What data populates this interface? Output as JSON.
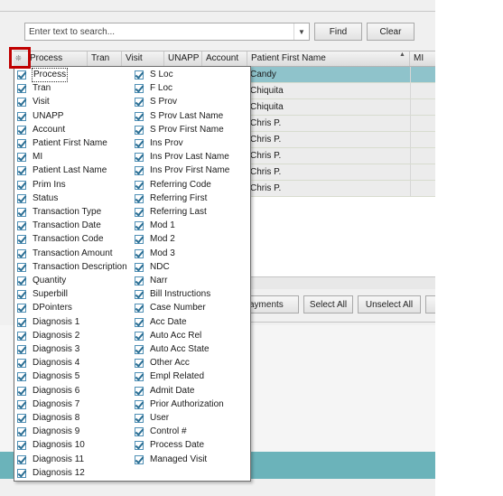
{
  "search": {
    "placeholder": "Enter text to search...",
    "value": ""
  },
  "buttons": {
    "find": "Find",
    "clear": "Clear",
    "payments_partial": "ayments",
    "select_all": "Select All",
    "unselect_all": "Unselect All"
  },
  "grid": {
    "columns": [
      "Process",
      "Tran",
      "Visit",
      "UNAPP",
      "Account",
      "Patient First Name",
      "MI"
    ],
    "rows": [
      {
        "patient_first_name": "Candy",
        "selected": true
      },
      {
        "patient_first_name": "Chiquita",
        "selected": false
      },
      {
        "patient_first_name": "Chiquita",
        "selected": false
      },
      {
        "patient_first_name": "Chris P.",
        "selected": false
      },
      {
        "patient_first_name": "Chris P.",
        "selected": false
      },
      {
        "patient_first_name": "Chris P.",
        "selected": false
      },
      {
        "patient_first_name": "Chris P.",
        "selected": false
      },
      {
        "patient_first_name": "Chris P.",
        "selected": false
      }
    ]
  },
  "column_chooser": {
    "left": [
      "Process",
      "Tran",
      "Visit",
      "UNAPP",
      "Account",
      "Patient First Name",
      "MI",
      "Patient Last Name",
      "Prim Ins",
      "Status",
      "Transaction Type",
      "Transaction Date",
      "Transaction Code",
      "Transaction Amount",
      "Transaction Description",
      "Quantity",
      "Superbill",
      "DPointers",
      "Diagnosis 1",
      "Diagnosis 2",
      "Diagnosis 3",
      "Diagnosis 4",
      "Diagnosis 5",
      "Diagnosis 6",
      "Diagnosis 7",
      "Diagnosis 8",
      "Diagnosis 9",
      "Diagnosis 10",
      "Diagnosis 11",
      "Diagnosis 12"
    ],
    "right": [
      "S Loc",
      "F Loc",
      "S Prov",
      "S Prov Last Name",
      "S Prov First Name",
      "Ins Prov",
      "Ins Prov Last Name",
      "Ins Prov First Name",
      "Referring Code",
      "Referring First",
      "Referring Last",
      "Mod 1",
      "Mod 2",
      "Mod 3",
      "NDC",
      "Narr",
      "Bill Instructions",
      "Case Number",
      "Acc Date",
      "Auto Acc Rel",
      "Auto Acc State",
      "Other Acc",
      "Empl Related",
      "Admit Date",
      "Prior Authorization",
      "User",
      "Control #",
      "Process Date",
      "Managed Visit"
    ],
    "all_checked": true,
    "focused_item": "Process"
  },
  "colors": {
    "selected_row": "#8fc3cb",
    "highlight_box": "#c00000",
    "teal_strip": "#6bb3ba"
  },
  "icons": {
    "column_chooser": "column-chooser-icon",
    "dropdown": "chevron-down-icon",
    "sort": "sort-ascending-icon"
  }
}
